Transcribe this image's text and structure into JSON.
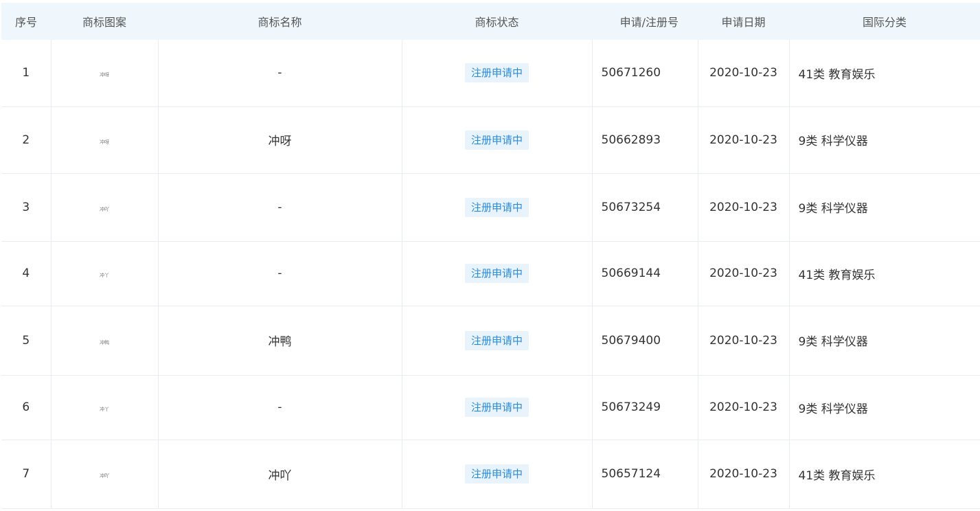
{
  "headers": {
    "index": "序号",
    "logo": "商标图案",
    "name": "商标名称",
    "status": "商标状态",
    "reg_no": "申请/注册号",
    "date": "申请日期",
    "class": "国际分类"
  },
  "rows": [
    {
      "index": "1",
      "logo_text": "冲呀",
      "name": "-",
      "status": "注册申请中",
      "reg_no": "50671260",
      "date": "2020-10-23",
      "class": "41类 教育娱乐"
    },
    {
      "index": "2",
      "logo_text": "冲呀",
      "name": "冲呀",
      "status": "注册申请中",
      "reg_no": "50662893",
      "date": "2020-10-23",
      "class": "9类 科学仪器"
    },
    {
      "index": "3",
      "logo_text": "冲吖",
      "name": "-",
      "status": "注册申请中",
      "reg_no": "50673254",
      "date": "2020-10-23",
      "class": "9类 科学仪器"
    },
    {
      "index": "4",
      "logo_text": "冲丫",
      "name": "-",
      "status": "注册申请中",
      "reg_no": "50669144",
      "date": "2020-10-23",
      "class": "41类 教育娱乐"
    },
    {
      "index": "5",
      "logo_text": "冲鸭",
      "name": "冲鸭",
      "status": "注册申请中",
      "reg_no": "50679400",
      "date": "2020-10-23",
      "class": "9类 科学仪器"
    },
    {
      "index": "6",
      "logo_text": "冲丫",
      "name": "-",
      "status": "注册申请中",
      "reg_no": "50673249",
      "date": "2020-10-23",
      "class": "9类 科学仪器"
    },
    {
      "index": "7",
      "logo_text": "冲吖",
      "name": "冲吖",
      "status": "注册申请中",
      "reg_no": "50657124",
      "date": "2020-10-23",
      "class": "41类 教育娱乐"
    }
  ],
  "colors": {
    "header_bg": "#eff7fc",
    "status_bg": "#e8f3fc",
    "status_text": "#2b8bd8",
    "border": "#e8edf1"
  }
}
